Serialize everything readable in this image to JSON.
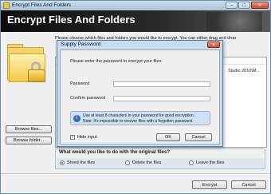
{
  "window": {
    "title": "Encrypt Files And Folders",
    "minimize_glyph": "–",
    "maximize_glyph": "□",
    "close_glyph": "✕"
  },
  "header": {
    "title": "Encrypt Files And Folders"
  },
  "main": {
    "instructions": "Please choose which files and folders you would like to encrypt. You can either drag and drop",
    "list_entry": "Studio 2010\\M...",
    "browse_files_label": "Browse files...",
    "browse_folder_label": "Browse folder..."
  },
  "original_files_group": {
    "title": "What would you like to do with the original files?",
    "options": [
      {
        "label": "Shred the files",
        "selected": true
      },
      {
        "label": "Delete the files",
        "selected": false
      },
      {
        "label": "Leave the files",
        "selected": false
      }
    ]
  },
  "footer": {
    "encrypt_label": "Encrypt",
    "cancel_label": "Cancel"
  },
  "dialog": {
    "title": "Supply Password",
    "close_glyph": "✕",
    "message": "Please enter the password to encrypt your files.",
    "password_label": "Password",
    "confirm_label": "Confirm password",
    "note_icon": "info-icon",
    "note_icon_glyph": "i",
    "note_line1": "Use at least 8 characters in your password for good encryption.",
    "note_line2": "Note: It's impossible to recover files with a forgotten password.",
    "hide_input_label": "Hide input",
    "hide_input_checked": true,
    "check_glyph": "✓",
    "ok_label": "OK",
    "cancel_label": "Cancel"
  },
  "colors": {
    "header_background": "#111111",
    "accent": "#2f6fb8"
  }
}
